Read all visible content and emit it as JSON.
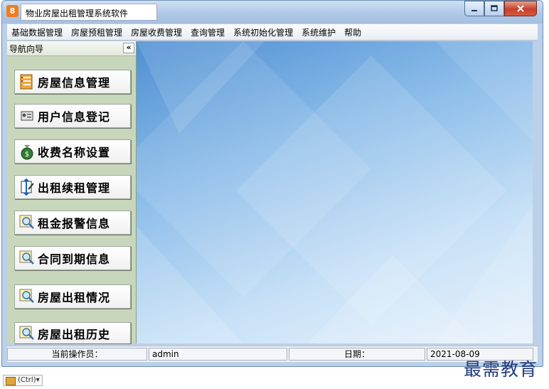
{
  "window": {
    "title": "物业房屋出租管理系统软件",
    "app_icon_glyph": "8"
  },
  "menu": [
    {
      "label": "基础数据管理"
    },
    {
      "label": "房屋预租管理"
    },
    {
      "label": "房屋收费管理"
    },
    {
      "label": "查询管理"
    },
    {
      "label": "系统初始化管理"
    },
    {
      "label": "系统维护"
    },
    {
      "label": "帮助"
    }
  ],
  "sidebar": {
    "title": "导航向导",
    "collapse_label": "«",
    "items": [
      {
        "label": "房屋信息管理",
        "icon": "house-info-icon"
      },
      {
        "label": "用户信息登记",
        "icon": "user-card-icon"
      },
      {
        "label": "收费名称设置",
        "icon": "money-bag-icon"
      },
      {
        "label": "出租续租管理",
        "icon": "lease-edit-icon"
      },
      {
        "label": "租金报警信息",
        "icon": "magnifier-alert-icon"
      },
      {
        "label": "合同到期信息",
        "icon": "magnifier-contract-icon"
      },
      {
        "label": "房屋出租情况",
        "icon": "magnifier-status-icon"
      },
      {
        "label": "房屋出租历史",
        "icon": "magnifier-history-icon"
      }
    ]
  },
  "status": {
    "operator_label": "当前操作员：",
    "operator_value": "admin",
    "date_label": "日期：",
    "date_value": "2021-08-09"
  },
  "paste_tag": {
    "label": "(Ctrl)▾"
  },
  "watermark": "最需教育",
  "colors": {
    "accent": "#f07c1c",
    "content_blue": "#4f8fd3"
  }
}
